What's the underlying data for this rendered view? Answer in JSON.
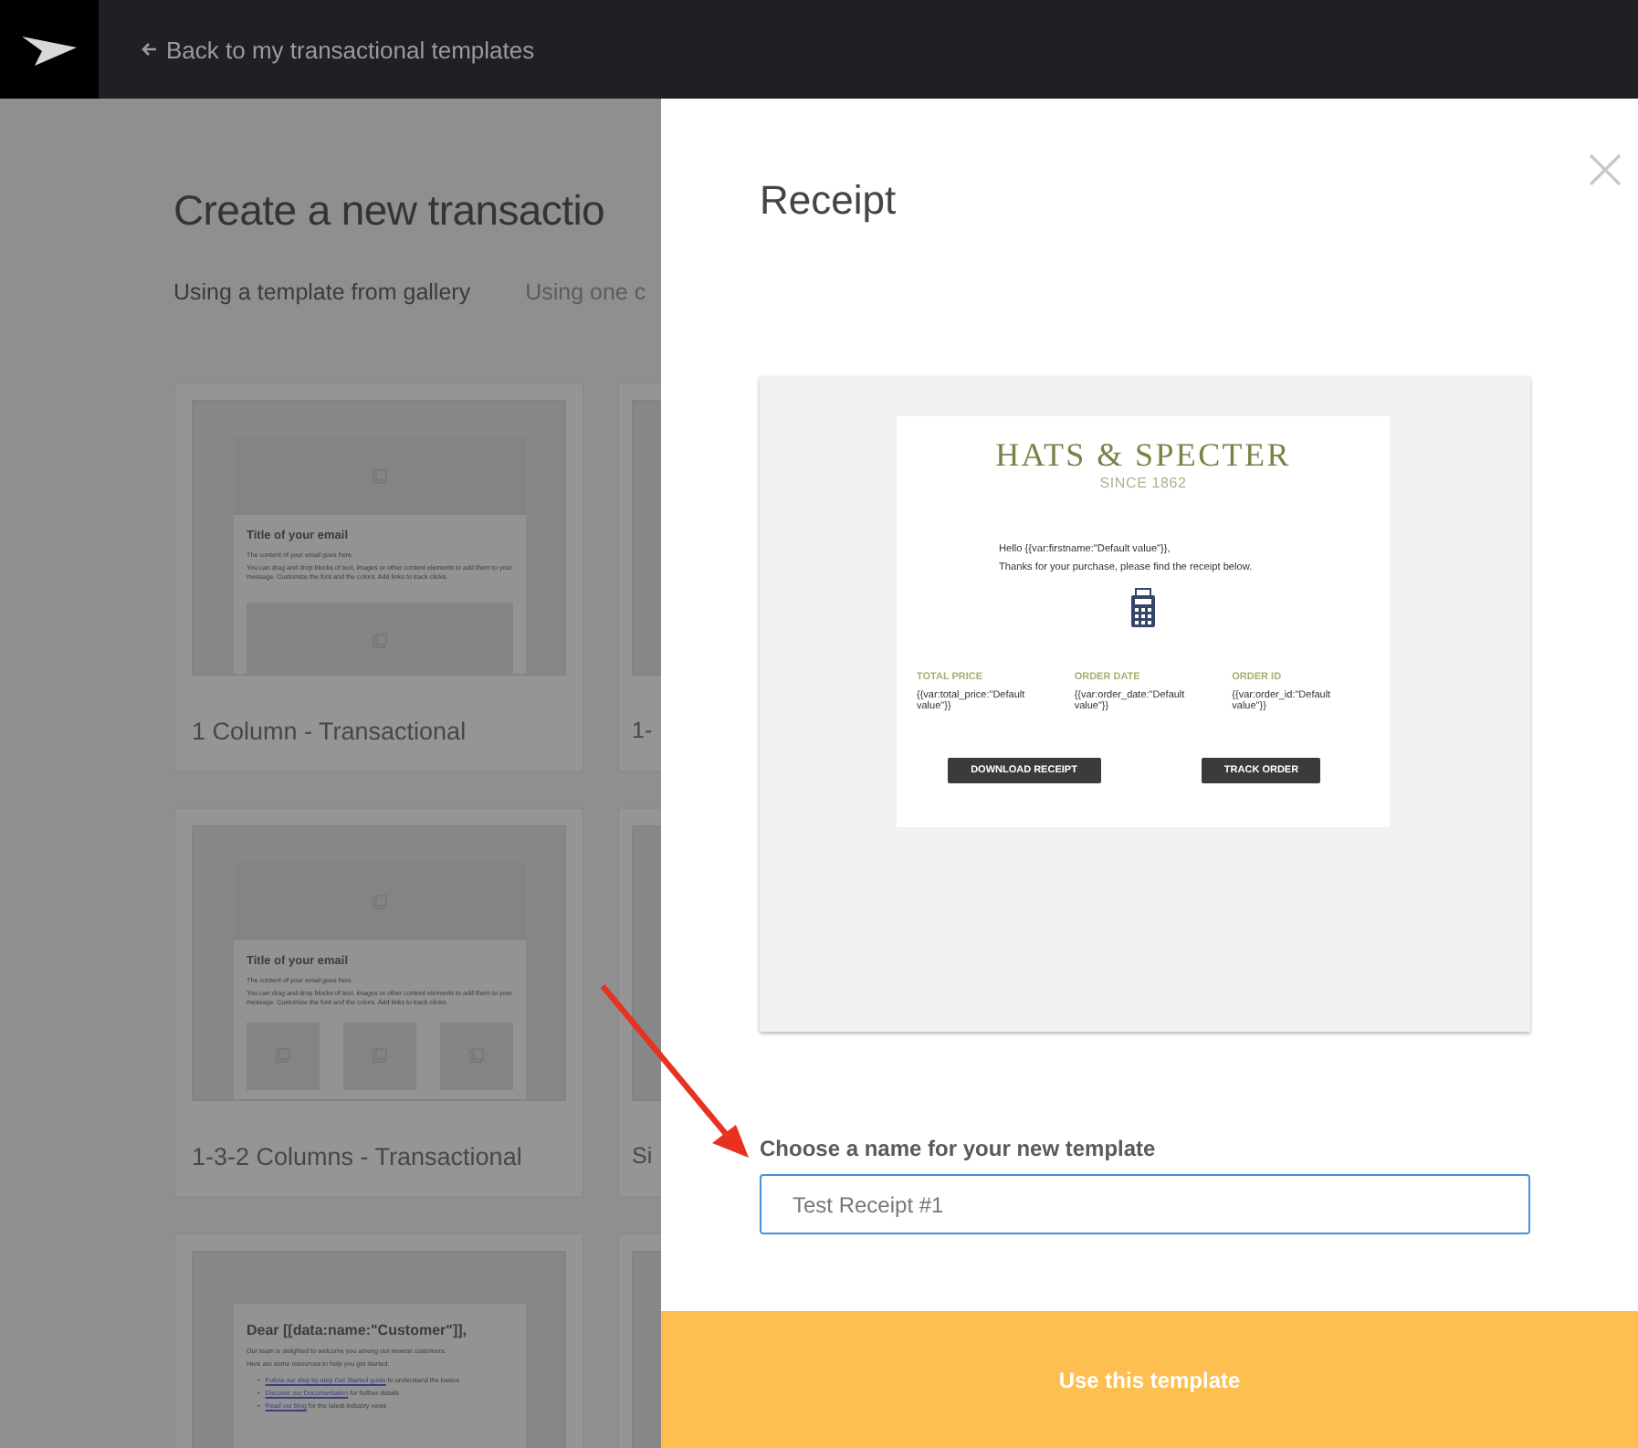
{
  "header": {
    "back_link": "Back to my transactional templates"
  },
  "gallery": {
    "title": "Create a new transactio",
    "tabs": [
      {
        "label": "Using a template from gallery",
        "selected": true
      },
      {
        "label": "Using one c",
        "selected": false
      }
    ],
    "templates": [
      {
        "kind": "one-column",
        "name": "1 Column - Transactional",
        "preview": {
          "title": "Title of your email",
          "lines": [
            "The content of your email goes here.",
            "You can drag and drop blocks of text, images or other content elements to add them to your message. Customize the font and the colors. Add links to track clicks."
          ]
        }
      },
      {
        "kind": "cut",
        "name": "1-"
      },
      {
        "kind": "three-column",
        "name": "1-3-2 Columns - Transactional",
        "preview": {
          "title": "Title of your email",
          "lines": [
            "The content of your email goes here.",
            "You can drag and drop blocks of text, images or other content elements to add them to your message. Customize the font and the colors. Add links to track clicks."
          ]
        }
      },
      {
        "kind": "cut",
        "name": "Si"
      },
      {
        "kind": "welcome",
        "preview": {
          "title": "Dear [[data:name:\"Customer\"]],",
          "lines": [
            "Our team is delighted to welcome you among our newest customers.",
            "Here are some resources to help you get started:"
          ],
          "links": [
            {
              "bullet": "•",
              "link": "Follow our step by step Get Started guide",
              "rest": " to understand the basics"
            },
            {
              "bullet": "•",
              "link": "Discover our Documentation",
              "rest": " for further details"
            },
            {
              "bullet": "•",
              "link": "Read our blog",
              "rest": " for the latest industry news"
            }
          ]
        }
      },
      {
        "kind": "cut"
      }
    ]
  },
  "modal": {
    "title": "Receipt",
    "preview": {
      "brand": "HATS & SPECTER",
      "since": "SINCE 1862",
      "greeting": "Hello {{var:firstname:\"Default value\"}},",
      "message": "Thanks for your purchase, please find the receipt below.",
      "fields": [
        {
          "label": "TOTAL PRICE",
          "value": "{{var:total_price:\"Default value\"}}"
        },
        {
          "label": "ORDER DATE",
          "value": "{{var:order_date:\"Default value\"}}"
        },
        {
          "label": "ORDER ID",
          "value": "{{var:order_id:\"Default value\"}}"
        }
      ],
      "buttons": [
        "DOWNLOAD RECEIPT",
        "TRACK ORDER"
      ]
    },
    "name_label": "Choose a name for your new template",
    "name_value": "Test Receipt #1",
    "submit": "Use this template"
  },
  "annotation": {
    "kind": "arrow"
  }
}
